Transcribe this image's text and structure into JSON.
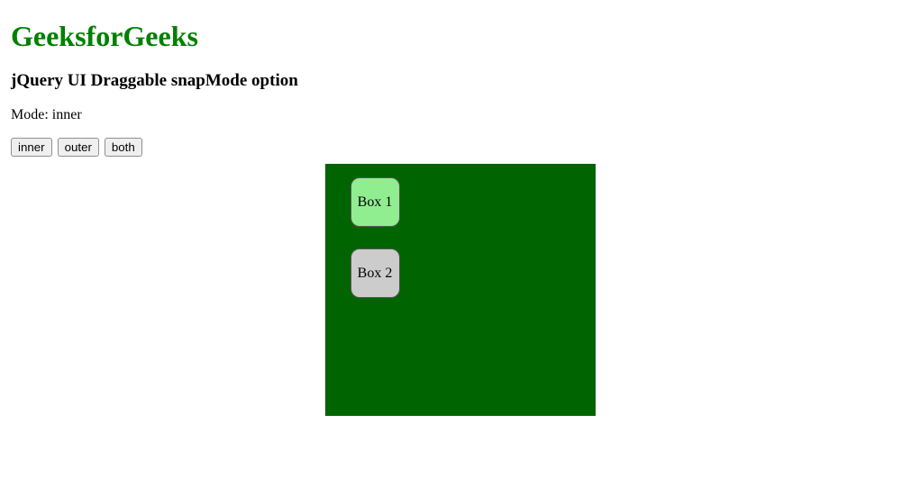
{
  "brand": "GeeksforGeeks",
  "subtitle": "jQuery UI Draggable snapMode option",
  "mode_prefix": "Mode: ",
  "mode_value": "inner",
  "buttons": {
    "inner": "inner",
    "outer": "outer",
    "both": "both"
  },
  "boxes": {
    "box1": "Box 1",
    "box2": "Box 2"
  }
}
